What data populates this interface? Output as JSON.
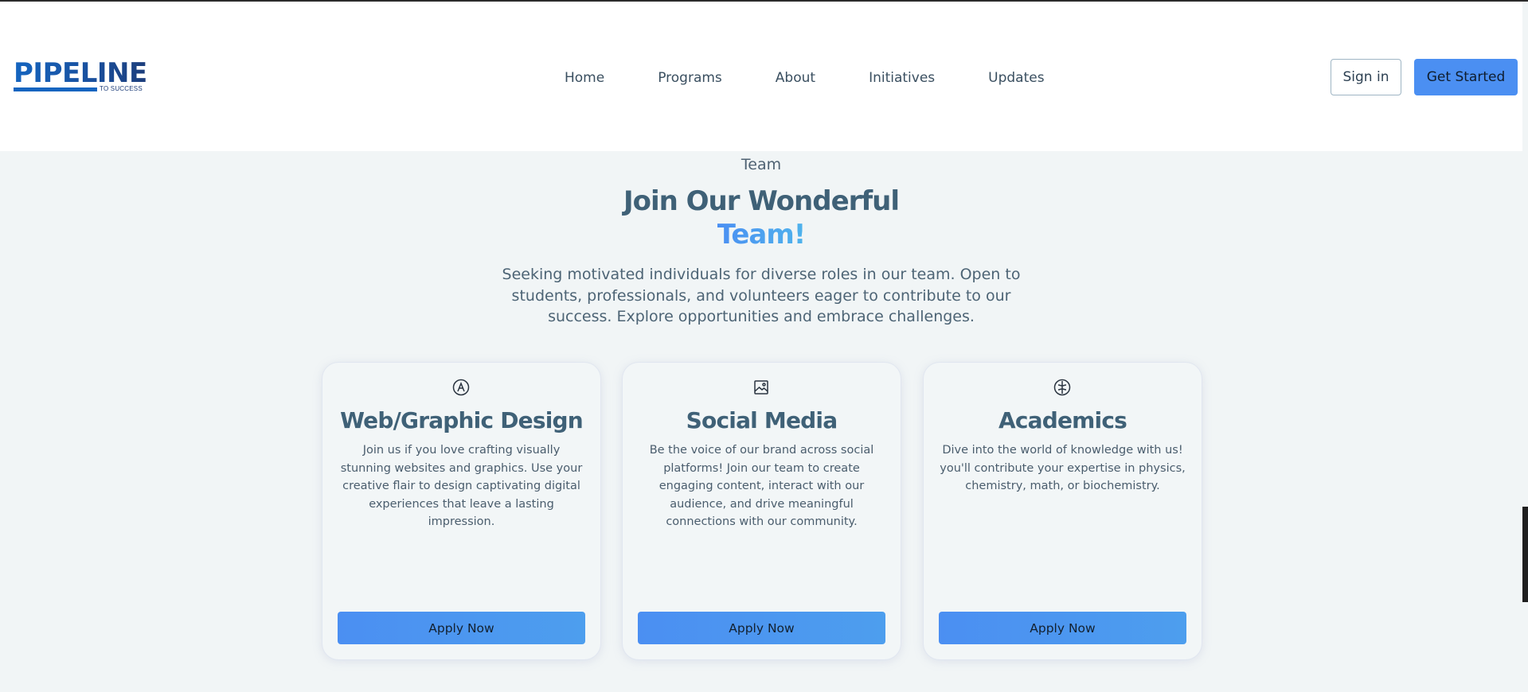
{
  "logo": {
    "main": "PIPELINE",
    "sub": "TO SUCCESS"
  },
  "nav": {
    "items": [
      "Home",
      "Programs",
      "About",
      "Initiatives",
      "Updates"
    ]
  },
  "header_actions": {
    "sign_in": "Sign in",
    "get_started": "Get Started"
  },
  "section": {
    "eyebrow": "Team",
    "title": "Join Our Wonderful",
    "title_accent": "Team!",
    "lead": "Seeking motivated individuals for diverse roles in our team. Open to students, professionals, and volunteers eager to contribute to our success. Explore opportunities and embrace challenges."
  },
  "cards": [
    {
      "icon": "pen-circle-icon",
      "title": "Web/Graphic Design",
      "body": "Join us if you love crafting visually stunning websites and graphics. Use your creative flair to design captivating digital experiences that leave a lasting impression.",
      "button": "Apply Now"
    },
    {
      "icon": "image-icon",
      "title": "Social Media",
      "body": "Be the voice of our brand across social platforms! Join our team to create engaging content, interact with our audience, and drive meaningful connections with our community.",
      "button": "Apply Now"
    },
    {
      "icon": "brain-icon",
      "title": "Academics",
      "body": "Dive into the world of knowledge with us! you'll contribute your expertise in physics, chemistry, math, or biochemistry.",
      "button": "Apply Now"
    }
  ],
  "colors": {
    "accent": "#4b8ff2",
    "heading": "#3f6177",
    "background": "#f1f5f6"
  }
}
